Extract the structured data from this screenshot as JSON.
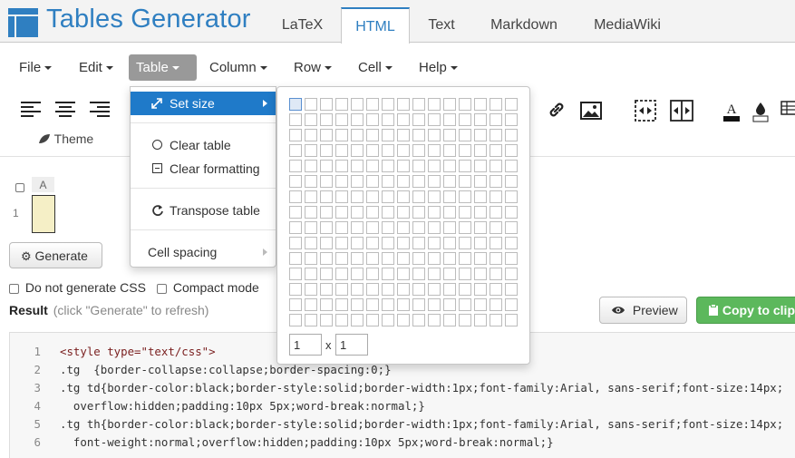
{
  "app": {
    "title": "Tables Generator",
    "brand_color": "#2f7fc1"
  },
  "nav": {
    "tabs": [
      "LaTeX",
      "HTML",
      "Text",
      "Markdown",
      "MediaWiki"
    ],
    "active": "HTML"
  },
  "menu": {
    "items": [
      "File",
      "Edit",
      "Table",
      "Column",
      "Row",
      "Cell",
      "Help"
    ],
    "active": "Table"
  },
  "toolbar": {
    "theme_label": "Theme"
  },
  "mini_table": {
    "col_header": "A",
    "row_header": "1",
    "cell_color": "#f5efc6"
  },
  "actions": {
    "generate_label": "Generate",
    "no_css_label": "Do not generate CSS",
    "compact_label": "Compact mode",
    "result_label": "Result",
    "result_hint": "(click \"Generate\" to refresh)",
    "preview_label": "Preview",
    "copy_label": "Copy to clip",
    "copy_color": "#5cb85c"
  },
  "code": {
    "lines": [
      {
        "n": "1",
        "text": "<style type=\"text/css\">"
      },
      {
        "n": "2",
        "text": ".tg  {border-collapse:collapse;border-spacing:0;}"
      },
      {
        "n": "3",
        "text": ".tg td{border-color:black;border-style:solid;border-width:1px;font-family:Arial, sans-serif;font-size:14px;"
      },
      {
        "n": "4",
        "text": "  overflow:hidden;padding:10px 5px;word-break:normal;}"
      },
      {
        "n": "5",
        "text": ".tg th{border-color:black;border-style:solid;border-width:1px;font-family:Arial, sans-serif;font-size:14px;"
      },
      {
        "n": "6",
        "text": "  font-weight:normal;overflow:hidden;padding:10px 5px;word-break:normal;}"
      }
    ]
  },
  "table_menu": {
    "set_size": "Set size",
    "clear_table": "Clear table",
    "clear_formatting": "Clear formatting",
    "transpose": "Transpose table",
    "cell_spacing": "Cell spacing",
    "highlight_color": "#1f7ac9"
  },
  "size_picker": {
    "rows": 15,
    "cols": 15,
    "selected_rows": 1,
    "selected_cols": 1,
    "rows_value": "1",
    "times": "x",
    "cols_value": "1"
  }
}
